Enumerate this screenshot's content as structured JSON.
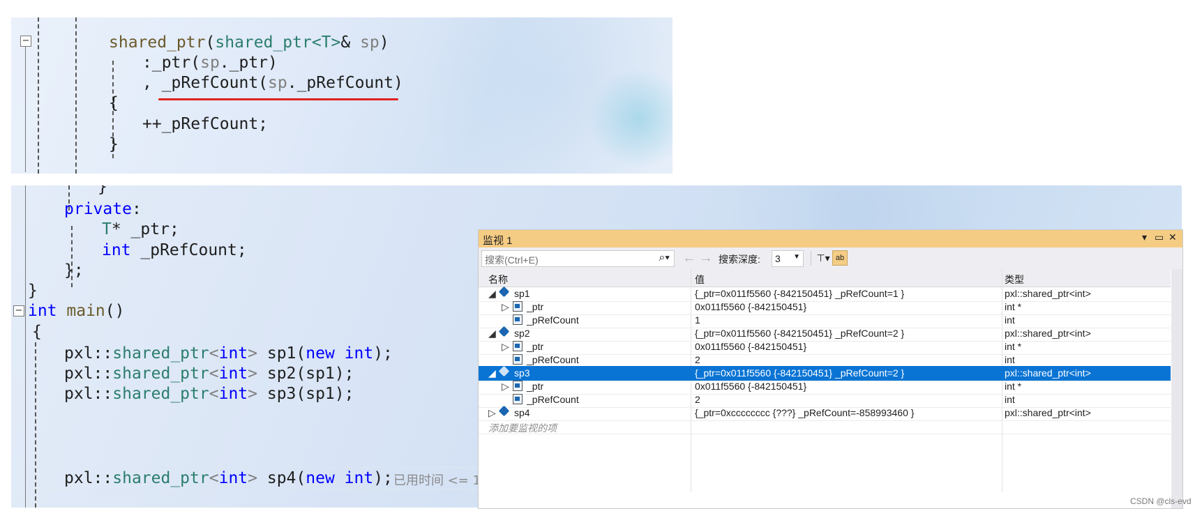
{
  "top_code": {
    "line1_fn": "shared_ptr",
    "line1_p1": "(",
    "line1_ty": "shared_ptr<T>",
    "line1_p2": "& ",
    "line1_param": "sp",
    "line1_p3": ")",
    "line2_a": ":_ptr(",
    "line2_param": "sp",
    "line2_b": "._ptr)",
    "line3_a": ", _pRefCount(",
    "line3_param": "sp",
    "line3_b": "._pRefCount)",
    "line4": "{",
    "line5": "++_pRefCount;",
    "line6": "}"
  },
  "bottom_code": {
    "line0": "}",
    "private_kw": "private",
    "private_colon": ":",
    "field1_ty": "T",
    "field1_rest": "* _ptr;",
    "field2_kw": "int",
    "field2_rest": " _pRefCount;",
    "close_class": "};",
    "close_ns": "}",
    "main_kw": "int",
    "main_name": " main",
    "main_parens": "()",
    "open_brace": "{",
    "lines": [
      {
        "ns": "pxl::",
        "ty": "shared_ptr",
        "lt": "<",
        "kw": "int",
        "gt": ">",
        "name": " sp1(",
        "new": "new",
        "sp": " ",
        "int2": "int",
        "end": ");"
      },
      {
        "ns": "pxl::",
        "ty": "shared_ptr",
        "lt": "<",
        "kw": "int",
        "gt": ">",
        "name": " sp2(sp1);"
      },
      {
        "ns": "pxl::",
        "ty": "shared_ptr",
        "lt": "<",
        "kw": "int",
        "gt": ">",
        "name": " sp3(sp1);"
      },
      {
        "ns": "pxl::",
        "ty": "shared_ptr",
        "lt": "<",
        "kw": "int",
        "gt": ">",
        "name": " sp4(",
        "new": "new",
        "sp": " ",
        "int2": "int",
        "end": ");"
      }
    ],
    "elapsed_hint": "已用时间 <= 1"
  },
  "watch": {
    "title": "监视 1",
    "ctrl_dropdown": "▾",
    "ctrl_max": "▭",
    "ctrl_close": "✕",
    "search_placeholder": "搜索(Ctrl+E)",
    "search_icon": "search-icon",
    "depth_label": "搜索深度:",
    "depth_value": "3",
    "columns": {
      "name": "名称",
      "value": "值",
      "type": "类型"
    },
    "rows": [
      {
        "tri": "◢",
        "name": "sp1",
        "value": "{_ptr=0x011f5560 {-842150451} _pRefCount=1 }",
        "type": "pxl::shared_ptr<int>"
      },
      {
        "tri": "▷",
        "name": "_ptr",
        "value": "0x011f5560 {-842150451}",
        "type": "int *"
      },
      {
        "tri": "",
        "name": "_pRefCount",
        "value": "1",
        "type": "int"
      },
      {
        "tri": "◢",
        "name": "sp2",
        "value": "{_ptr=0x011f5560 {-842150451} _pRefCount=2 }",
        "type": "pxl::shared_ptr<int>"
      },
      {
        "tri": "▷",
        "name": "_ptr",
        "value": "0x011f5560 {-842150451}",
        "type": "int *"
      },
      {
        "tri": "",
        "name": "_pRefCount",
        "value": "2",
        "type": "int"
      },
      {
        "tri": "◢",
        "name": "sp3",
        "value": "{_ptr=0x011f5560 {-842150451} _pRefCount=2 }",
        "type": "pxl::shared_ptr<int>"
      },
      {
        "tri": "▷",
        "name": "_ptr",
        "value": "0x011f5560 {-842150451}",
        "type": "int *"
      },
      {
        "tri": "",
        "name": "_pRefCount",
        "value": "2",
        "type": "int"
      },
      {
        "tri": "▷",
        "name": "sp4",
        "value": "{_ptr=0xcccccccc {???} _pRefCount=-858993460 }",
        "type": "pxl::shared_ptr<int>"
      }
    ],
    "add_item": "添加要监视的项"
  },
  "watermark": "CSDN @cls-evd",
  "colors": {
    "keyword": "#0000ff",
    "type": "#2b7d6d",
    "selection": "#0a74d4",
    "title_bar": "#f5cc84",
    "underline": "#e02020"
  }
}
